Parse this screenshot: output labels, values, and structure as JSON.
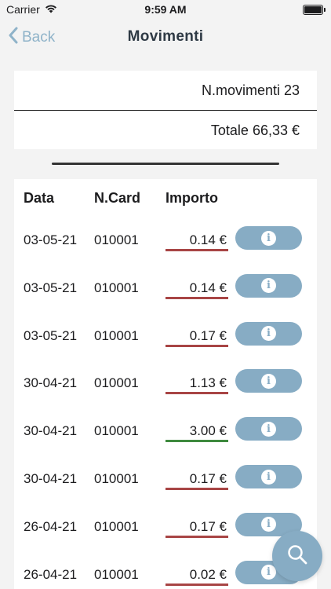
{
  "status_bar": {
    "carrier": "Carrier",
    "time": "9:59 AM"
  },
  "nav": {
    "back_label": "Back",
    "title": "Movimenti"
  },
  "summary": {
    "count": "N.movimenti 23",
    "total": "Totale 66,33 €"
  },
  "table": {
    "headers": {
      "data": "Data",
      "card": "N.Card",
      "importo": "Importo"
    },
    "rows": [
      {
        "date": "03-05-21",
        "card": "010001",
        "amount": "0.14 €",
        "type": "debit"
      },
      {
        "date": "03-05-21",
        "card": "010001",
        "amount": "0.14 €",
        "type": "debit"
      },
      {
        "date": "03-05-21",
        "card": "010001",
        "amount": "0.17 €",
        "type": "debit"
      },
      {
        "date": "30-04-21",
        "card": "010001",
        "amount": "1.13 €",
        "type": "debit"
      },
      {
        "date": "30-04-21",
        "card": "010001",
        "amount": "3.00 €",
        "type": "credit"
      },
      {
        "date": "30-04-21",
        "card": "010001",
        "amount": "0.17 €",
        "type": "debit"
      },
      {
        "date": "26-04-21",
        "card": "010001",
        "amount": "0.17 €",
        "type": "debit"
      },
      {
        "date": "26-04-21",
        "card": "010001",
        "amount": "0.02 €",
        "type": "debit"
      }
    ]
  },
  "colors": {
    "accent": "#87acc4",
    "debit": "#a84545",
    "credit": "#3f8a3f",
    "back": "#8fb3c9"
  },
  "icons": {
    "info": "info-icon",
    "search": "search-icon",
    "back": "chevron-left-icon"
  },
  "info_glyph": "i"
}
